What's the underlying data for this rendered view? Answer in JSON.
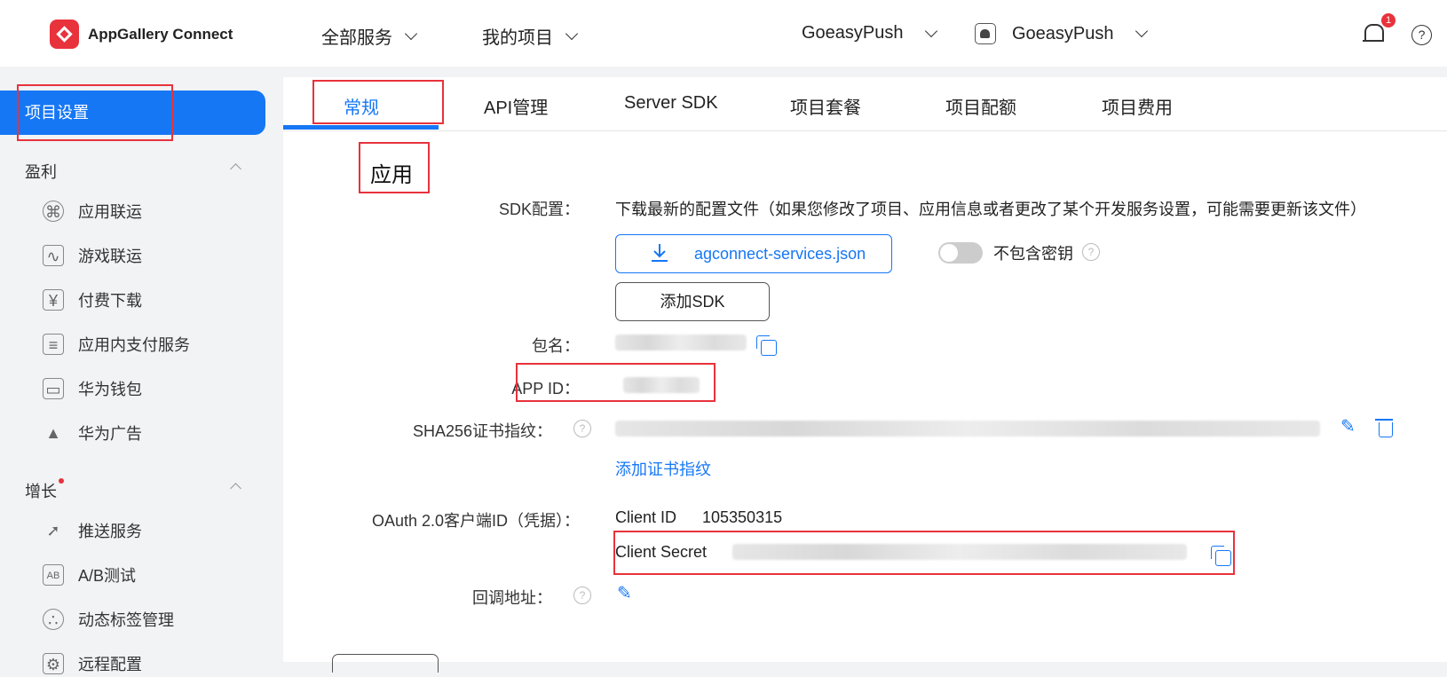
{
  "header": {
    "brand": "AppGallery Connect",
    "nav": [
      "全部服务",
      "我的项目"
    ],
    "project_selector": "GoeasyPush",
    "app_selector": "GoeasyPush",
    "notification_count": "1",
    "help": "?"
  },
  "sidebar": {
    "active": "项目设置",
    "groups": [
      {
        "label": "盈利",
        "items": [
          "应用联运",
          "游戏联运",
          "付费下载",
          "应用内支付服务",
          "华为钱包",
          "华为广告"
        ]
      },
      {
        "label": "增长",
        "items": [
          "推送服务",
          "A/B测试",
          "动态标签管理",
          "远程配置"
        ]
      }
    ]
  },
  "tabs": [
    "常规",
    "API管理",
    "Server SDK",
    "项目套餐",
    "项目配额",
    "项目费用"
  ],
  "section_title": "应用",
  "fields": {
    "sdk_label": "SDK配置：",
    "sdk_desc": "下载最新的配置文件（如果您修改了项目、应用信息或者更改了某个开发服务设置，可能需要更新该文件）",
    "download_label": "agconnect-services.json",
    "exclude_key_label": "不包含密钥",
    "add_sdk_label": "添加SDK",
    "package_label": "包名：",
    "appid_label": "APP ID：",
    "sha_label": "SHA256证书指纹：",
    "add_cert_label": "添加证书指纹",
    "oauth_label": "OAuth 2.0客户端ID（凭据）：",
    "client_id_label": "Client ID",
    "client_id_value": "105350315",
    "client_secret_label": "Client Secret",
    "callback_label": "回调地址："
  }
}
